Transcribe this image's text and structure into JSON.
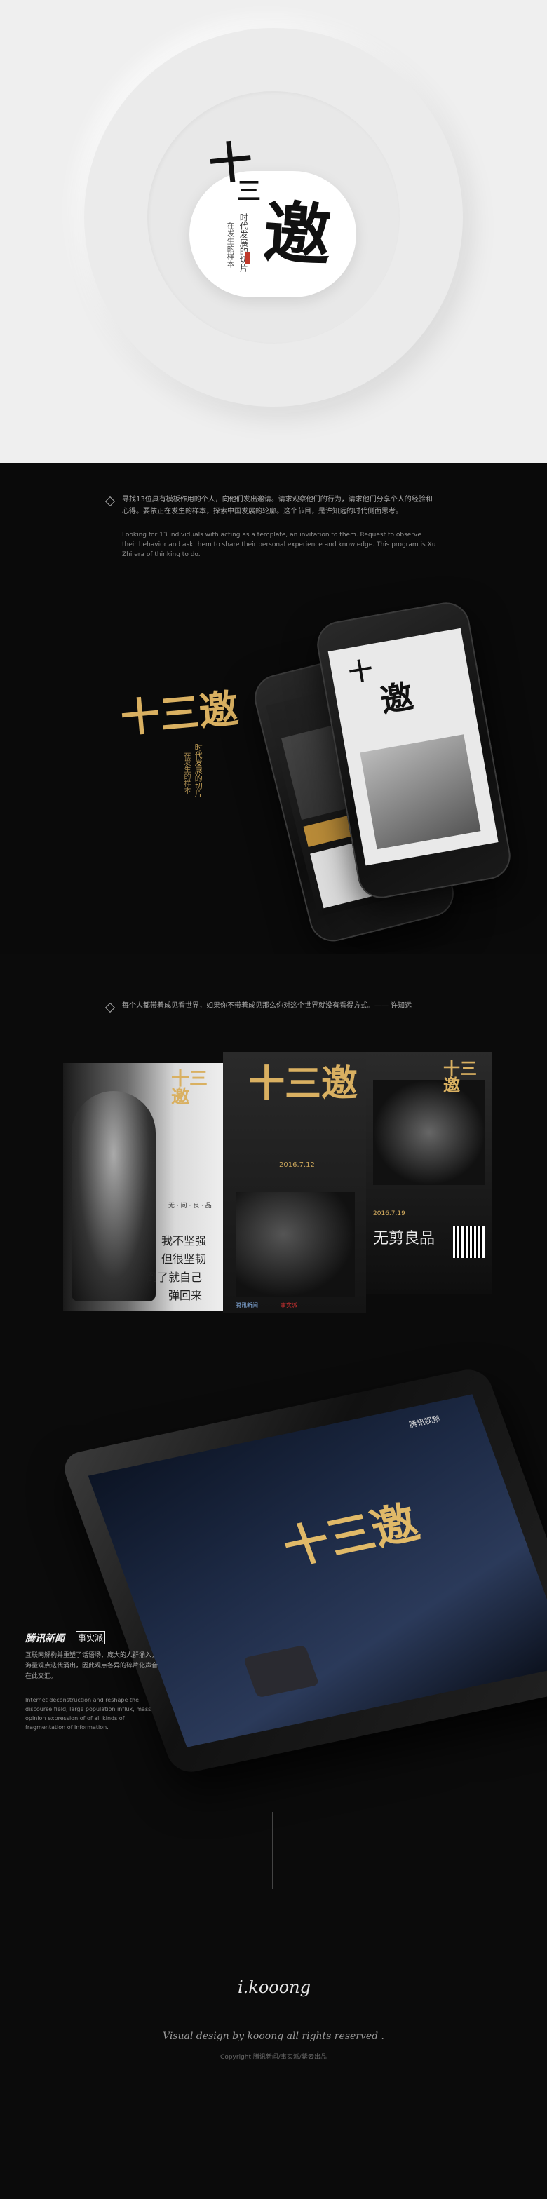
{
  "hero": {
    "title_char_1": "十",
    "title_char_2": "三",
    "title_char_3": "邀",
    "vertical_1": "时代发展的切片",
    "vertical_2": "在发生的样本"
  },
  "intro": {
    "cn": "寻找13位具有模板作用的个人，向他们发出邀请。请求观察他们的行为，请求他们分享个人的经验和心得。要依正在发生的样本，探索中国发展的轮廓。这个节目，是许知远的时代侧面思考。",
    "en": "Looking for 13 individuals with acting as a template, an invitation to them. Request to observe their behavior and ask them to share their personal experience and knowledge. This program is Xu Zhi era of thinking to do."
  },
  "logo_block": {
    "title": "十三邀",
    "vertical_1": "时代发展的切片",
    "vertical_2": "在发生的样本"
  },
  "quote": {
    "text": "每个人都带着成见看世界，如果你不带着成见那么你对这个世界就没有看得方式。—— 许知远"
  },
  "posters": {
    "left": {
      "title": "十三邀",
      "name_tag": "无 · 问 · 良 · 品",
      "quote_1": "我不坚强",
      "quote_2": "但很坚韧",
      "quote_3": "倒了就自己",
      "quote_4": "弹回来"
    },
    "center": {
      "title": "十三邀",
      "date": "2016.7.12",
      "brand_1": "腾讯新闻",
      "brand_2": "事实派"
    },
    "right": {
      "title": "十三邀",
      "date": "2016.7.19",
      "headline": "无剪良品"
    }
  },
  "feature": {
    "brand_1": "腾讯新闻",
    "brand_2": "事实派",
    "cn": "互联网解构并重塑了话语场，庞大的人群涌入，海量观点迭代涌出，因此观点各异的碎片化声音在此交汇。",
    "en": "Internet deconstruction and reshape the discourse field, large population influx, mass opinion expression of of all kinds of fragmentation of information."
  },
  "tablet": {
    "badge": "腾讯视频",
    "title": "十三邀"
  },
  "footer": {
    "signature": "i.kooong",
    "credit": "Visual design by kooong all rights reserved .",
    "copyright": "Copyright 腾讯新闻/事实派/紫云出品"
  },
  "colors": {
    "gold": "#d9b061",
    "dark_bg": "#0b0b0b",
    "light_bg": "#efefef",
    "seal_red": "#c0392b"
  }
}
